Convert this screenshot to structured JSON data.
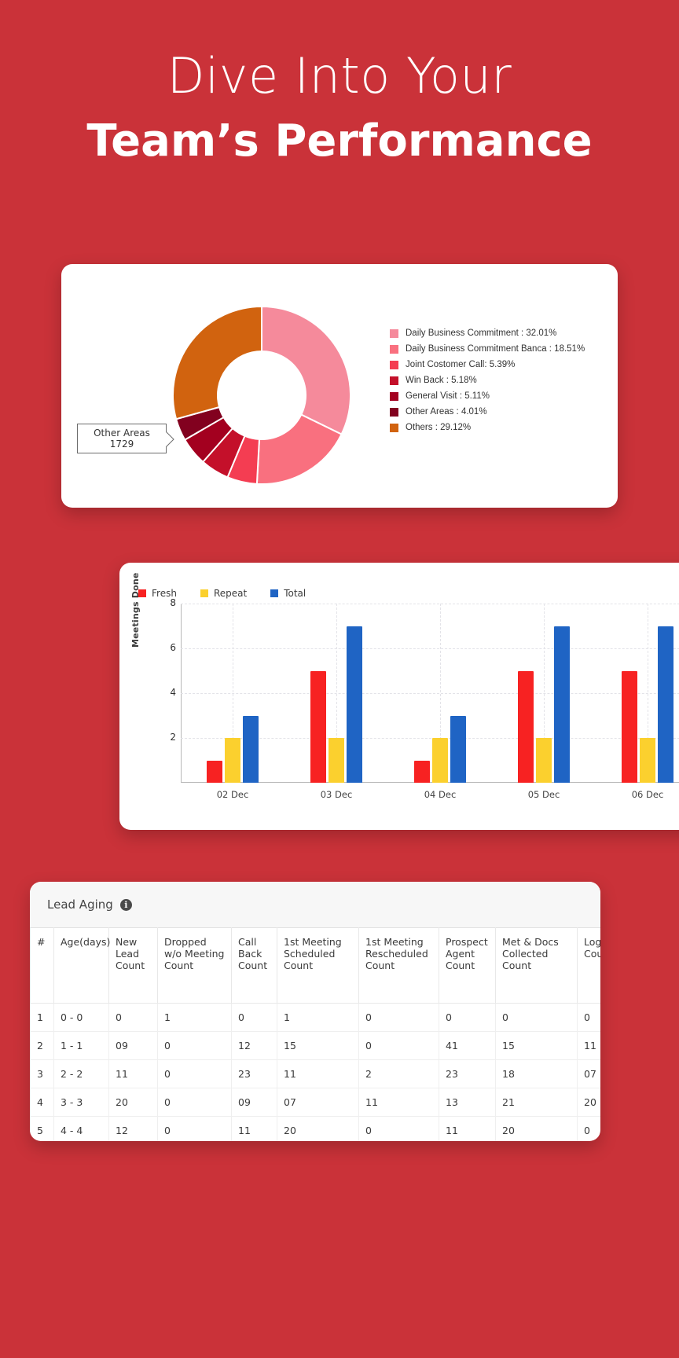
{
  "theme": {
    "background": "#ca3239",
    "card": "#ffffff"
  },
  "headline": {
    "line1": "Dive Into Your",
    "line2": "Team’s Performance"
  },
  "donut_card": {
    "tooltip": {
      "label": "Other Areas",
      "value": "1729"
    }
  },
  "bar_card": {},
  "table": {
    "title": "Lead Aging",
    "info_icon": "info-icon",
    "columns": [
      "#",
      "Age(days)",
      "New Lead Count",
      "Dropped w/o Meeting Count",
      "Call Back Count",
      "1st Meeting Scheduled Count",
      "1st Meeting Rescheduled Count",
      "Prospect Agent Count",
      "Met & Docs Collected Count",
      "Login Count"
    ],
    "rows": [
      [
        "1",
        "0 - 0",
        "0",
        "1",
        "0",
        "1",
        "0",
        "0",
        "0",
        "0"
      ],
      [
        "2",
        "1 - 1",
        "09",
        "0",
        "12",
        "15",
        "0",
        "41",
        "15",
        "11"
      ],
      [
        "3",
        "2 - 2",
        "11",
        "0",
        "23",
        "11",
        "2",
        "23",
        "18",
        "07"
      ],
      [
        "4",
        "3 - 3",
        "20",
        "0",
        "09",
        "07",
        "11",
        "13",
        "21",
        "20"
      ],
      [
        "5",
        "4 - 4",
        "12",
        "0",
        "11",
        "20",
        "0",
        "11",
        "20",
        "0"
      ]
    ]
  },
  "chart_data": [
    {
      "type": "pie",
      "title": "",
      "subtype": "donut",
      "legend_position": "right",
      "labels": [
        "Daily Business Commitment",
        "Daily Business Commitment Banca",
        "Joint Costomer Call",
        "Win Back",
        "General Visit",
        "Other Areas",
        "Others"
      ],
      "legend_entries": [
        "Daily Business Commitment : 32.01%",
        "Daily Business Commitment Banca : 18.51%",
        "Joint Costomer Call: 5.39%",
        "Win Back : 5.18%",
        "General Visit : 5.11%",
        "Other Areas : 4.01%",
        "Others : 29.12%"
      ],
      "values": [
        32.01,
        18.51,
        5.39,
        5.18,
        5.11,
        4.01,
        29.12
      ],
      "colors": [
        "#f58a9b",
        "#f9707f",
        "#f43d52",
        "#c4102a",
        "#a3001f",
        "#82011f",
        "#d1630f"
      ],
      "annotation": {
        "label": "Other Areas",
        "value": 1729
      }
    },
    {
      "type": "bar",
      "title": "",
      "xlabel": "",
      "ylabel": "Meetings Done",
      "categories": [
        "02 Dec",
        "03 Dec",
        "04 Dec",
        "05 Dec",
        "06 Dec"
      ],
      "yticks": [
        2,
        4,
        6,
        8
      ],
      "ylim": [
        0,
        8
      ],
      "grid": true,
      "legend_position": "top-left",
      "series": [
        {
          "name": "Fresh",
          "color": "#f72222",
          "values": [
            1,
            5,
            1,
            5,
            5
          ]
        },
        {
          "name": "Repeat",
          "color": "#fbd02e",
          "values": [
            2,
            2,
            2,
            2,
            2
          ]
        },
        {
          "name": "Total",
          "color": "#1f64c4",
          "values": [
            3,
            7,
            3,
            7,
            7
          ]
        }
      ]
    }
  ]
}
